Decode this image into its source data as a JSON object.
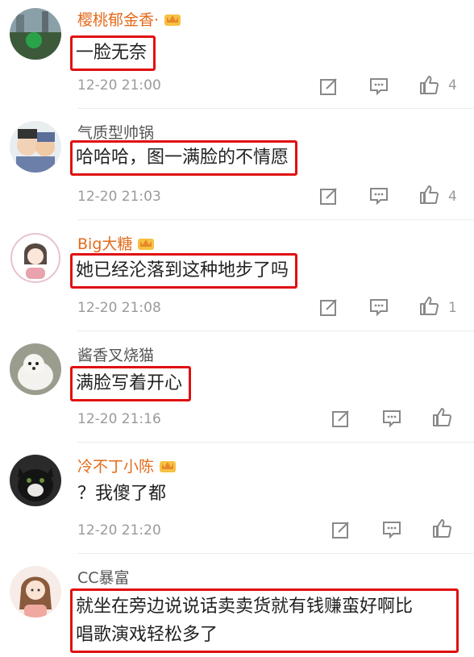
{
  "comments": [
    {
      "user": "樱桃郁金香·",
      "vip": true,
      "text": "一脸无奈",
      "time": "12-20 21:00",
      "likes": "4"
    },
    {
      "user": "气质型帅锅",
      "vip": false,
      "text": "哈哈哈，图一满脸的不情愿",
      "time": "12-20 21:03",
      "likes": "4"
    },
    {
      "user": "Big大糖",
      "vip": true,
      "text": "她已经沦落到这种地步了吗",
      "time": "12-20 21:08",
      "likes": "1"
    },
    {
      "user": "酱香叉烧猫",
      "vip": false,
      "text": "满脸写着开心",
      "time": "12-20 21:16",
      "likes": ""
    },
    {
      "user": "冷不丁小陈",
      "vip": true,
      "text": "？我傻了都",
      "time": "12-20 21:20",
      "likes": ""
    },
    {
      "user": "CC暴富",
      "vip": false,
      "text_line1": "就坐在旁边说说话卖卖货就有钱赚蛮好啊比",
      "text_line2": "唱歌演戏轻松多了"
    }
  ],
  "colors": {
    "highlight_box": "#e01010",
    "vip_name": "#e36b1b",
    "meta": "#9a9a9a"
  }
}
